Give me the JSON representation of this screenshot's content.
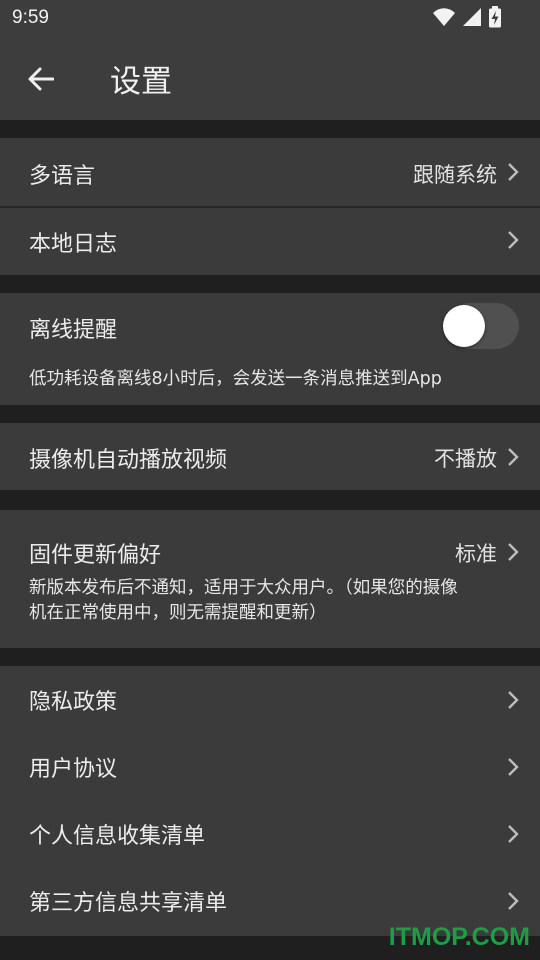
{
  "status_bar": {
    "time": "9:59"
  },
  "app_bar": {
    "title": "设置"
  },
  "language": {
    "label": "多语言",
    "value": "跟随系统"
  },
  "local_log": {
    "label": "本地日志"
  },
  "offline_reminder": {
    "label": "离线提醒",
    "enabled": false,
    "description": "低功耗设备离线8小时后，会发送一条消息推送到App"
  },
  "camera_autoplay": {
    "label": "摄像机自动播放视频",
    "value": "不播放"
  },
  "firmware_update": {
    "label": "固件更新偏好",
    "value": "标准",
    "description_line1": "新版本发布后不通知，适用于大众用户。（如果您的摄像",
    "description_line2": "机在正常使用中，则无需提醒和更新）"
  },
  "legal": {
    "privacy_policy": "隐私政策",
    "user_agreement": "用户协议",
    "personal_info_list": "个人信息收集清单",
    "third_party_sharing_list": "第三方信息共享清单"
  },
  "watermark": "ITMOP.COM",
  "colors": {
    "accent_watermark": "#1e9c46",
    "card_bg": "#3b3b3b",
    "page_bg": "#1f1f1f"
  }
}
